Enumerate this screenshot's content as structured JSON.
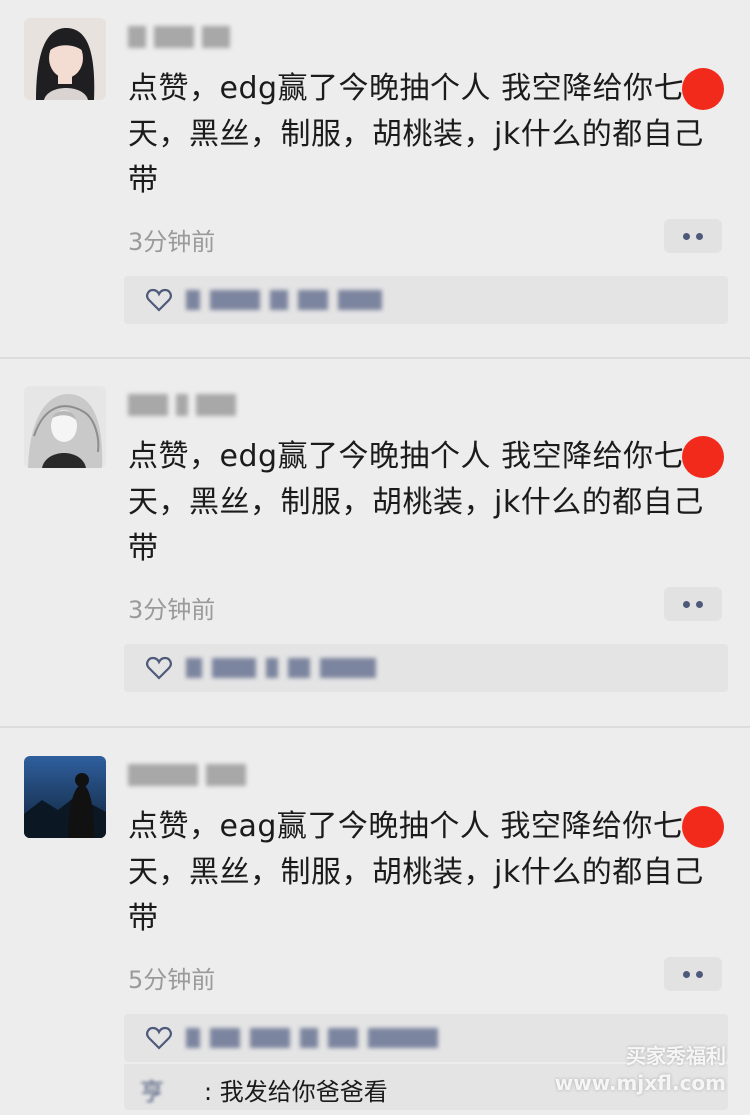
{
  "posts": [
    {
      "content": "点赞，edg赢了今晚抽个人 我空降给你七天，黑丝，制服，胡桃装，jk什么的都自己带",
      "time": "3分钟前"
    },
    {
      "content": "点赞，edg赢了今晚抽个人 我空降给你七天，黑丝，制服，胡桃装，jk什么的都自己带",
      "time": "3分钟前"
    },
    {
      "content": "点赞，eag赢了今晚抽个人 我空降给你七天，黑丝，制服，胡桃装，jk什么的都自己带",
      "time": "5分钟前",
      "comment": {
        "user": "亨",
        "text": ": 我发给你爸爸看"
      }
    }
  ],
  "watermark": {
    "line1": "买家秀福利",
    "line2": "www.mjxfl.com"
  }
}
